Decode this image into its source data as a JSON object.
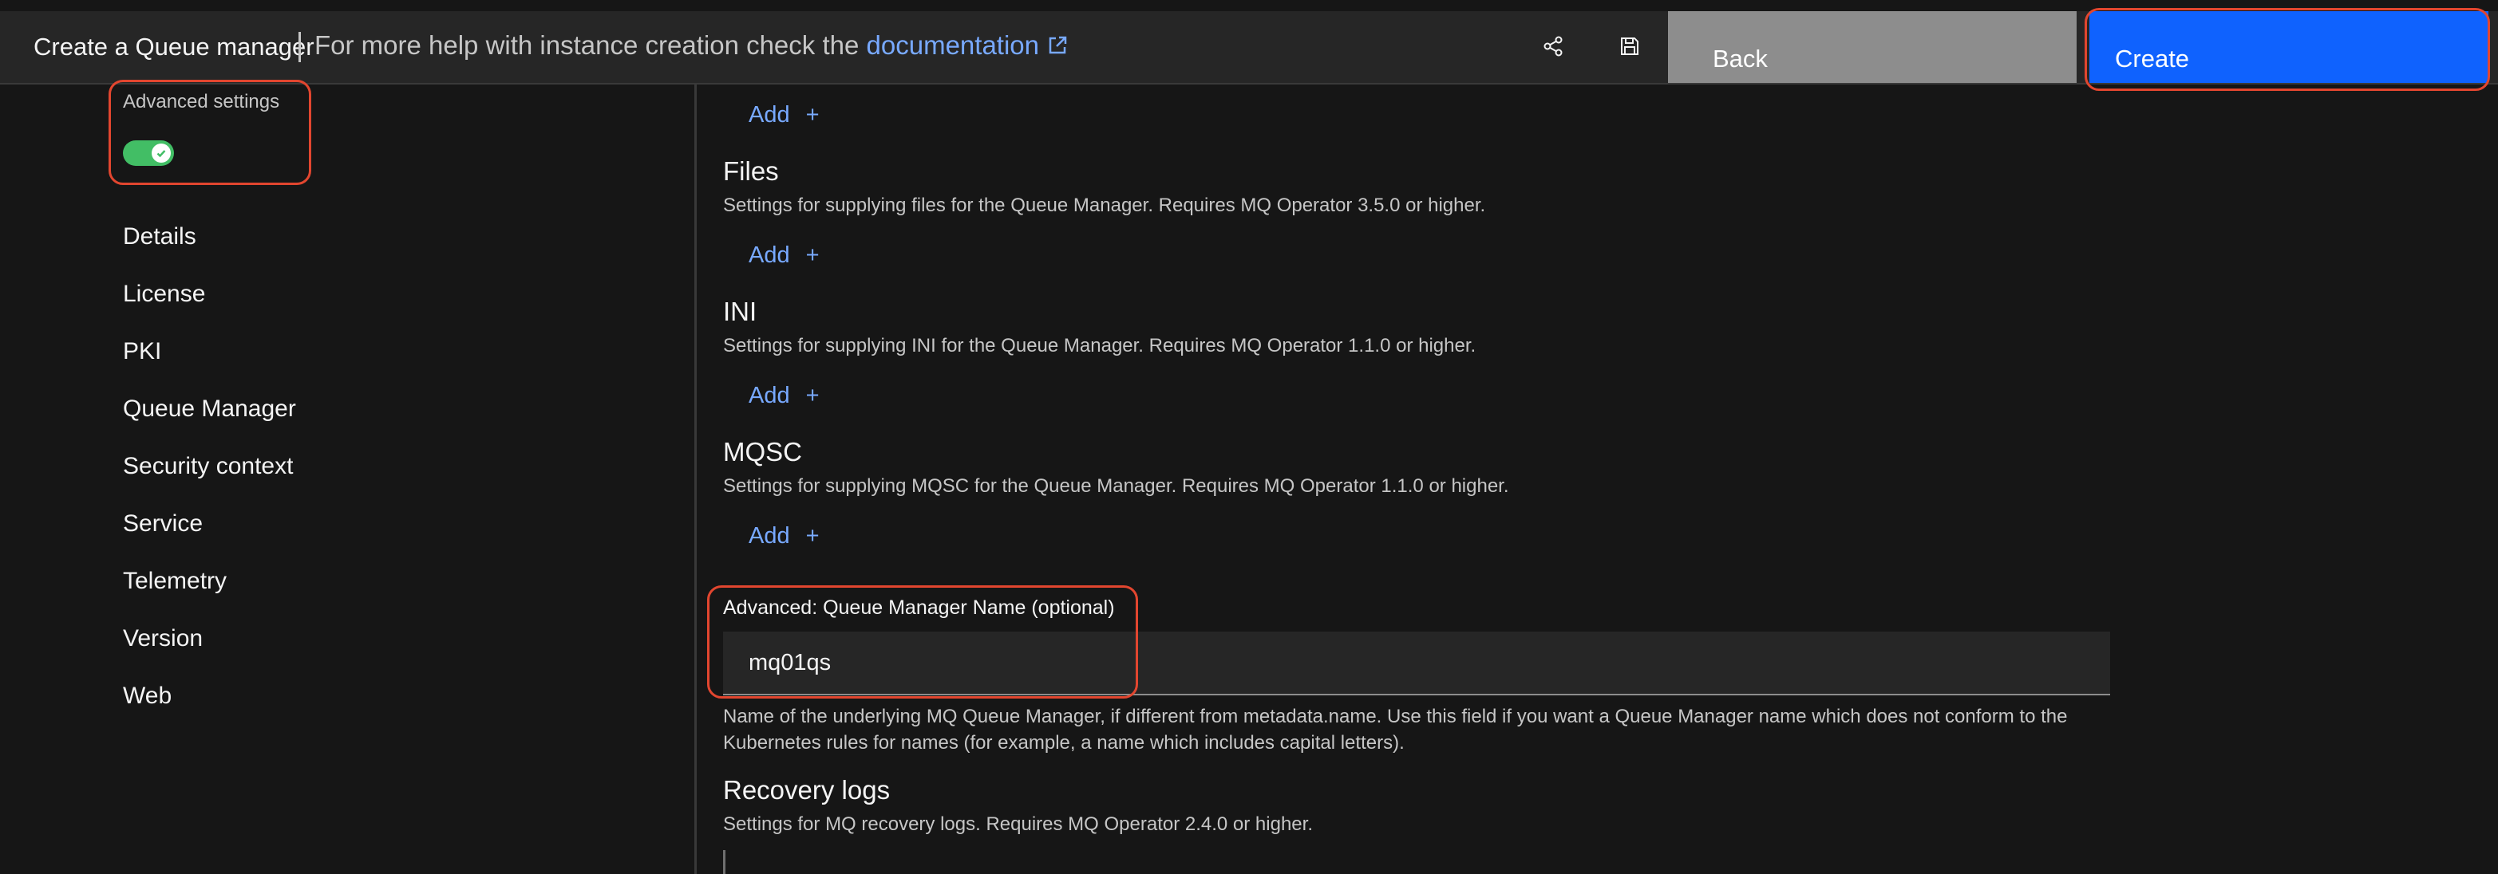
{
  "header": {
    "title": "Create a Queue manager",
    "help_text": "For more help with instance creation check the",
    "help_link": "documentation",
    "back_label": "Back",
    "create_label": "Create"
  },
  "sidebar": {
    "advanced_settings_label": "Advanced settings",
    "advanced_settings_enabled": true,
    "items": [
      {
        "label": "Details"
      },
      {
        "label": "License"
      },
      {
        "label": "PKI"
      },
      {
        "label": "Queue Manager"
      },
      {
        "label": "Security context"
      },
      {
        "label": "Service"
      },
      {
        "label": "Telemetry"
      },
      {
        "label": "Version"
      },
      {
        "label": "Web"
      }
    ]
  },
  "main": {
    "add_label": "Add",
    "add_symbol": "+",
    "sections": [
      {
        "title": "Files",
        "description": "Settings for supplying files for the Queue Manager. Requires MQ Operator 3.5.0 or higher."
      },
      {
        "title": "INI",
        "description": "Settings for supplying INI for the Queue Manager. Requires MQ Operator 1.1.0 or higher."
      },
      {
        "title": "MQSC",
        "description": "Settings for supplying MQSC for the Queue Manager. Requires MQ Operator 1.1.0 or higher."
      }
    ],
    "qm_name_field": {
      "label": "Advanced: Queue Manager Name (optional)",
      "value": "mq01qs",
      "help": "Name of the underlying MQ Queue Manager, if different from metadata.name. Use this field if you want a Queue Manager name which does not conform to the Kubernetes rules for names (for example, a name which includes capital letters)."
    },
    "recovery_logs": {
      "title": "Recovery logs",
      "description": "Settings for MQ recovery logs. Requires MQ Operator 2.4.0 or higher."
    }
  },
  "colors": {
    "background": "#161616",
    "topbar": "#262626",
    "primary_button": "#0f62fe",
    "secondary_button": "#8d8d8d",
    "link": "#78a9ff",
    "toggle_on": "#42be65",
    "highlight": "#e2462f"
  }
}
